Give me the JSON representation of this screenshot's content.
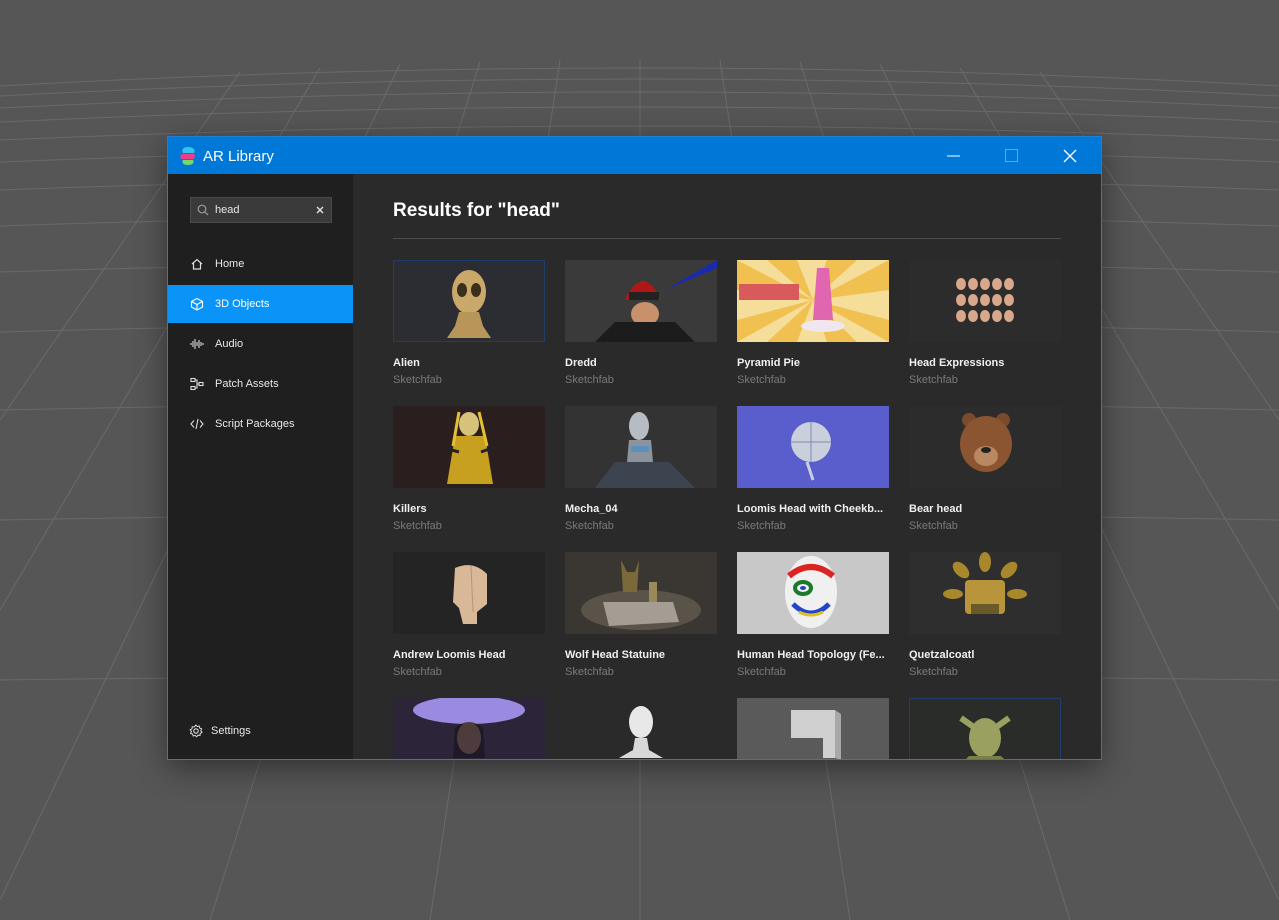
{
  "window": {
    "title": "AR Library",
    "accent_color": "#0078d7"
  },
  "search": {
    "value": "head",
    "clear_label": "×"
  },
  "sidebar": {
    "items": [
      {
        "label": "Home",
        "icon": "home-icon",
        "active": false
      },
      {
        "label": "3D Objects",
        "icon": "cube-icon",
        "active": true
      },
      {
        "label": "Audio",
        "icon": "audio-wave-icon",
        "active": false
      },
      {
        "label": "Patch Assets",
        "icon": "patch-nodes-icon",
        "active": false
      },
      {
        "label": "Script Packages",
        "icon": "code-icon",
        "active": false
      }
    ],
    "settings_label": "Settings",
    "active_color": "#0a94f7"
  },
  "main": {
    "results_title": "Results for \"head\"",
    "cards": [
      {
        "title": "Alien",
        "source": "Sketchfab"
      },
      {
        "title": "Dredd",
        "source": "Sketchfab"
      },
      {
        "title": "Pyramid Pie",
        "source": "Sketchfab"
      },
      {
        "title": "Head Expressions",
        "source": "Sketchfab"
      },
      {
        "title": "Killers",
        "source": "Sketchfab"
      },
      {
        "title": "Mecha_04",
        "source": "Sketchfab"
      },
      {
        "title": "Loomis Head with Cheekb...",
        "source": "Sketchfab"
      },
      {
        "title": "Bear head",
        "source": "Sketchfab"
      },
      {
        "title": "Andrew Loomis Head",
        "source": "Sketchfab"
      },
      {
        "title": "Wolf Head Statuine",
        "source": "Sketchfab"
      },
      {
        "title": "Human Head Topology (Fe...",
        "source": "Sketchfab"
      },
      {
        "title": "Quetzalcoatl",
        "source": "Sketchfab"
      },
      {
        "title": "",
        "source": ""
      },
      {
        "title": "",
        "source": ""
      },
      {
        "title": "",
        "source": ""
      },
      {
        "title": "",
        "source": ""
      }
    ]
  }
}
